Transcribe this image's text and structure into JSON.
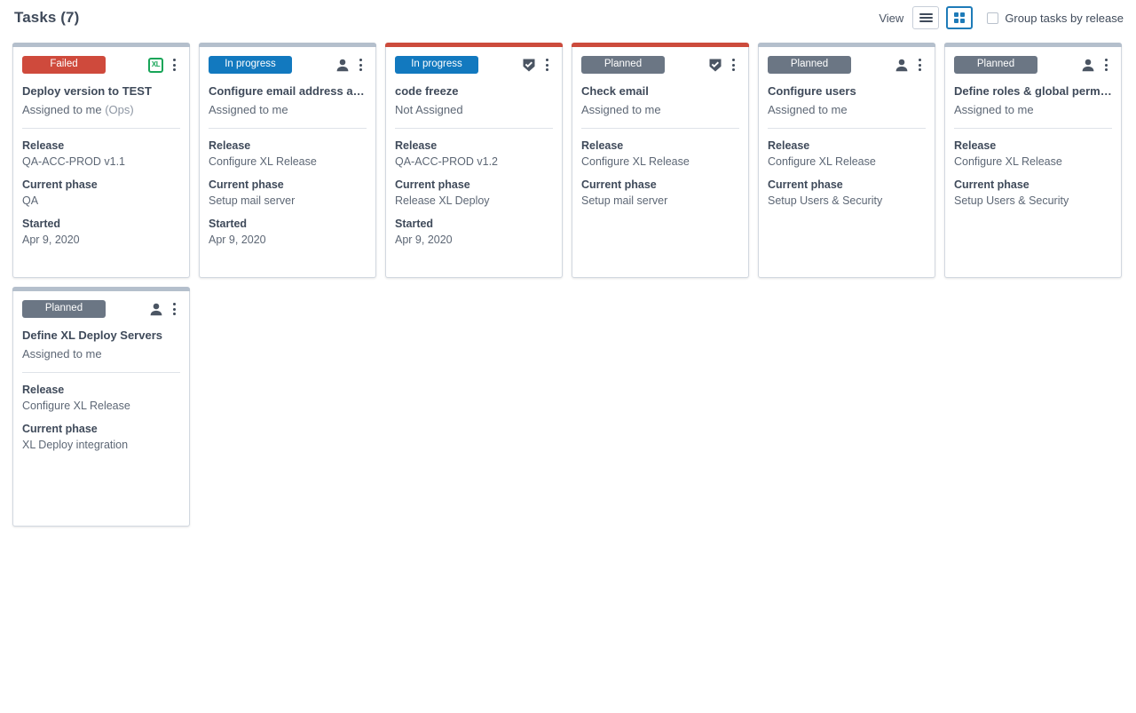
{
  "header": {
    "title": "Tasks (7)",
    "view_label": "View",
    "list_view_icon": "hamburger-icon",
    "grid_view_icon": "grid-icon",
    "active_view": "grid",
    "group_by_release": {
      "label": "Group tasks by release",
      "checked": false
    }
  },
  "colors": {
    "accent_blue": "#1e7bb8",
    "badge_failed": "#cf4a3c",
    "badge_in_progress": "#1279bf",
    "badge_planned": "#6b7684",
    "card_accent_red": "#cc4b3c",
    "card_accent_grey": "#b4bfcc",
    "xl_green": "#18a558",
    "shield_dark": "#4b5563",
    "text_dark": "#3f4a5a",
    "text_muted": "#5d6775"
  },
  "labels": {
    "release": "Release",
    "current_phase": "Current phase",
    "started": "Started"
  },
  "cards": [
    {
      "accent": "grey",
      "status": "Failed",
      "status_kind": "failed",
      "icon": "xl-deploy-icon",
      "icon_label": "XL",
      "title": "Deploy version to TEST",
      "assignee": "Assigned to me",
      "assignee_team": "(Ops)",
      "release": "QA-ACC-PROD v1.1",
      "current_phase": "QA",
      "started": "Apr 9, 2020"
    },
    {
      "accent": "grey",
      "status": "In progress",
      "status_kind": "in-progress",
      "icon": "person-icon",
      "title": "Configure email address and ...",
      "assignee": "Assigned to me",
      "assignee_team": "",
      "release": "Configure XL Release",
      "current_phase": "Setup mail server",
      "started": "Apr 9, 2020"
    },
    {
      "accent": "red",
      "status": "In progress",
      "status_kind": "in-progress",
      "icon": "shield-check-icon",
      "title": "code freeze",
      "assignee": "Not Assigned",
      "assignee_team": "",
      "release": "QA-ACC-PROD v1.2",
      "current_phase": "Release XL Deploy",
      "started": "Apr 9, 2020"
    },
    {
      "accent": "red",
      "status": "Planned",
      "status_kind": "planned",
      "icon": "shield-check-icon",
      "title": "Check email",
      "assignee": "Assigned to me",
      "assignee_team": "",
      "release": "Configure XL Release",
      "current_phase": "Setup mail server",
      "started": ""
    },
    {
      "accent": "grey",
      "status": "Planned",
      "status_kind": "planned",
      "icon": "person-icon",
      "title": "Configure users",
      "assignee": "Assigned to me",
      "assignee_team": "",
      "release": "Configure XL Release",
      "current_phase": "Setup Users & Security",
      "started": ""
    },
    {
      "accent": "grey",
      "status": "Planned",
      "status_kind": "planned",
      "icon": "person-icon",
      "title": "Define roles & global permissi...",
      "assignee": "Assigned to me",
      "assignee_team": "",
      "release": "Configure XL Release",
      "current_phase": "Setup Users & Security",
      "started": ""
    },
    {
      "accent": "grey",
      "status": "Planned",
      "status_kind": "planned",
      "icon": "person-icon",
      "title": "Define XL Deploy Servers",
      "assignee": "Assigned to me",
      "assignee_team": "",
      "release": "Configure XL Release",
      "current_phase": "XL Deploy integration",
      "started": ""
    }
  ]
}
